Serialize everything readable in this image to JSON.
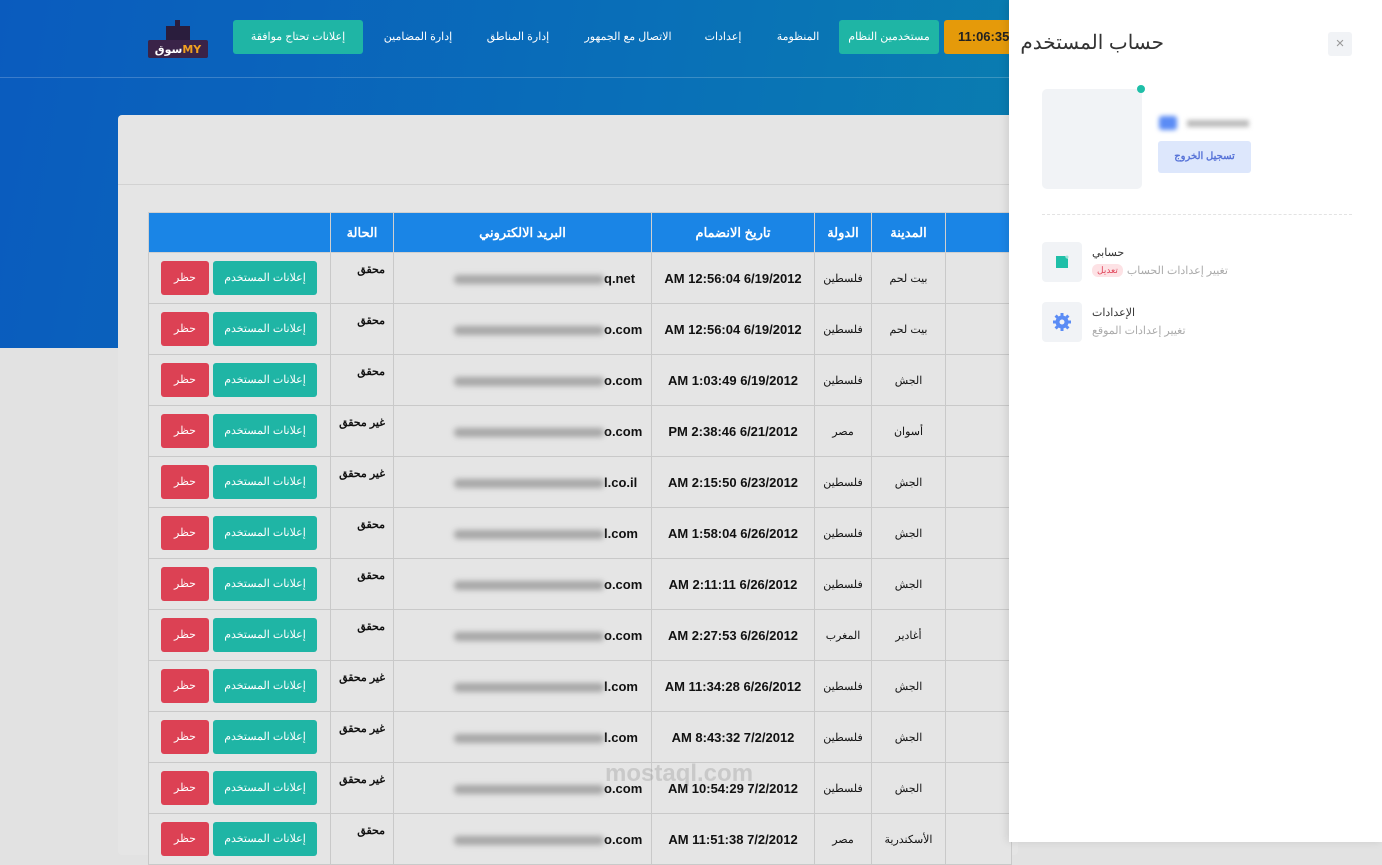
{
  "header": {
    "logo_text": "سوق MY",
    "clock": "11:06:35",
    "nav": [
      {
        "label": "إعلانات تحتاج موافقة",
        "button": true
      },
      {
        "label": "إدارة المضامين"
      },
      {
        "label": "إدارة المناطق"
      },
      {
        "label": "الاتصال مع الجمهور"
      },
      {
        "label": "إعدادات"
      },
      {
        "label": "المنظومة"
      },
      {
        "label": "مستخدمين النظام",
        "button": true
      }
    ]
  },
  "table": {
    "headers": {
      "city": "المدينة",
      "country": "الدولة",
      "joined": "تاريخ الانضمام",
      "email": "البريد الالكتروني",
      "status": "الحالة"
    },
    "actions": {
      "ads": "إعلانات المستخدم",
      "ban": "حظر"
    },
    "rows": [
      {
        "city": "بيت لحم",
        "country": "فلسطين",
        "joined": "AM 12:56:04 6/19/2012",
        "email_tail": "q.net",
        "status": "محقق"
      },
      {
        "city": "بيت لحم",
        "country": "فلسطين",
        "joined": "AM 12:56:04 6/19/2012",
        "email_tail": "o.com",
        "status": "محقق"
      },
      {
        "city": "الجش",
        "country": "فلسطين",
        "joined": "AM 1:03:49 6/19/2012",
        "email_tail": "o.com",
        "status": "محقق"
      },
      {
        "city": "أسوان",
        "country": "مصر",
        "joined": "PM 2:38:46 6/21/2012",
        "email_tail": "o.com",
        "status": "غير محقق"
      },
      {
        "city": "الجش",
        "country": "فلسطين",
        "joined": "AM 2:15:50 6/23/2012",
        "email_tail": "l.co.il",
        "status": "غير محقق"
      },
      {
        "city": "الجش",
        "country": "فلسطين",
        "joined": "AM 1:58:04 6/26/2012",
        "email_tail": "l.com",
        "status": "محقق"
      },
      {
        "city": "الجش",
        "country": "فلسطين",
        "joined": "AM 2:11:11 6/26/2012",
        "email_tail": "o.com",
        "status": "محقق"
      },
      {
        "city": "أغادير",
        "country": "المغرب",
        "joined": "AM 2:27:53 6/26/2012",
        "email_tail": "o.com",
        "status": "محقق"
      },
      {
        "city": "الجش",
        "country": "فلسطين",
        "joined": "AM 11:34:28 6/26/2012",
        "email_tail": "l.com",
        "status": "غير محقق"
      },
      {
        "city": "الجش",
        "country": "فلسطين",
        "joined": "AM 8:43:32 7/2/2012",
        "email_tail": "l.com",
        "status": "غير محقق"
      },
      {
        "city": "الجش",
        "country": "فلسطين",
        "joined": "AM 10:54:29 7/2/2012",
        "email_tail": "o.com",
        "status": "غير محقق"
      },
      {
        "city": "الأسكندرية",
        "country": "مصر",
        "joined": "AM 11:51:38 7/2/2012",
        "email_tail": "o.com",
        "status": "محقق"
      }
    ]
  },
  "watermark": "mostaql.com",
  "panel": {
    "title": "حساب المستخدم",
    "close": "×",
    "logout": "تسجيل الخروج",
    "items": [
      {
        "title": "حسابي",
        "subtitle": "تغيير إعدادات الحساب",
        "badge": "تعديل"
      },
      {
        "title": "الإعدادات",
        "subtitle": "تغيير إعدادات الموقع"
      }
    ]
  }
}
